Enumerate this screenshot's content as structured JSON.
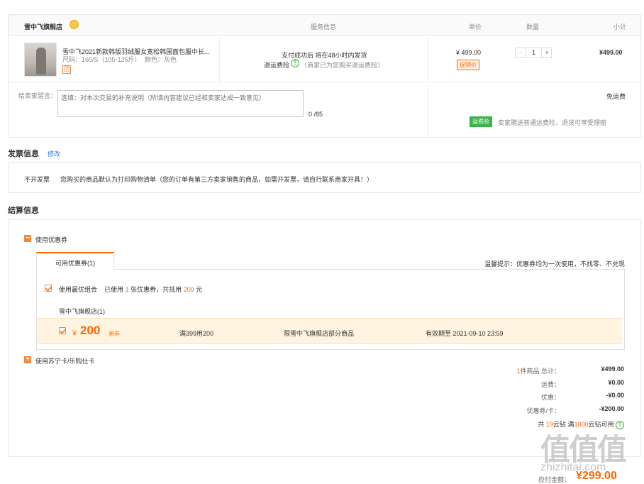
{
  "store_section": {
    "store_name": "雪中飞旗舰店",
    "headers": {
      "service": "服务信息",
      "price": "单价",
      "qty": "数量",
      "subtotal": "小计"
    },
    "product": {
      "title": "雪中飞2021新款韩版羽绒服女宽松韩国面包服中长...",
      "size": "尺码：160/S（105-125斤）",
      "color": "颜色：灰色",
      "tag": "团",
      "service_line1": "支付成功后 将在48小时内发货",
      "service_line2_label": "退运费险",
      "service_line2_note": "（商家已为您购买退运费险）",
      "price": "¥ 499.00",
      "promo_badge": "促销价",
      "qty": "1",
      "qty_minus": "−",
      "qty_plus": "+",
      "subtotal": "¥499.00"
    },
    "message": {
      "label": "给卖家留言：",
      "placeholder": "选填：对本次交易的补充说明（所填内容建议已经和卖家达成一致意见）",
      "counter": "0 /85"
    },
    "shipping": {
      "free_label": "免运费",
      "insurance_badge": "运费险",
      "insurance_note": "卖家赠送普通运费险，退货可享受理赔"
    }
  },
  "invoice": {
    "title": "发票信息",
    "edit_link": "修改",
    "type": "不开发票",
    "note": "您购买的商品默认为打印购物清单（您的订单有第三方卖家销售的商品，如需开发票，请自行联系商家开具！）"
  },
  "settlement": {
    "title": "结算信息",
    "coupon_toggle": "使用优惠券",
    "coupon_tab": "可用优惠券(1)",
    "tip": "温馨提示：优惠券均为一次使用，不找零、不兑现",
    "best_combo": {
      "label": "使用最优组合",
      "used_prefix": "已使用",
      "used_count": "1",
      "used_mid": "张优惠券，共抵用",
      "used_amount": "200",
      "used_suffix": "元"
    },
    "store_group": "雪中飞旗舰店(1)",
    "coupon": {
      "currency": "¥",
      "amount": "200",
      "kind": "易券",
      "condition": "满399用200",
      "scope": "限雪中飞旗舰店部分商品",
      "expiry": "有效期至 2021-09-10 23:59"
    },
    "card_toggle": "使用苏宁卡/乐购仕卡",
    "summary": {
      "goods_count": "1",
      "goods_label": "件商品 总计：",
      "goods_total": "¥499.00",
      "shipping_label": "运费：",
      "shipping_val": "¥0.00",
      "discount_label": "优惠：",
      "discount_val": "-¥0.00",
      "coupon_label": "优惠券/卡：",
      "coupon_val": "-¥200.00",
      "points_prefix": "共",
      "points_have": "19",
      "points_mid": "云钻 满",
      "points_need": "1000",
      "points_suffix": "云钻可用"
    },
    "payable_label": "应付金额：",
    "payable": "¥299.00"
  },
  "watermark": {
    "logo": "值值值",
    "url": "zhizhitai.com"
  },
  "colors": {
    "accent": "#ff6600",
    "badge_green": "#3bb24a",
    "coupon_bg": "#fff4e0"
  }
}
